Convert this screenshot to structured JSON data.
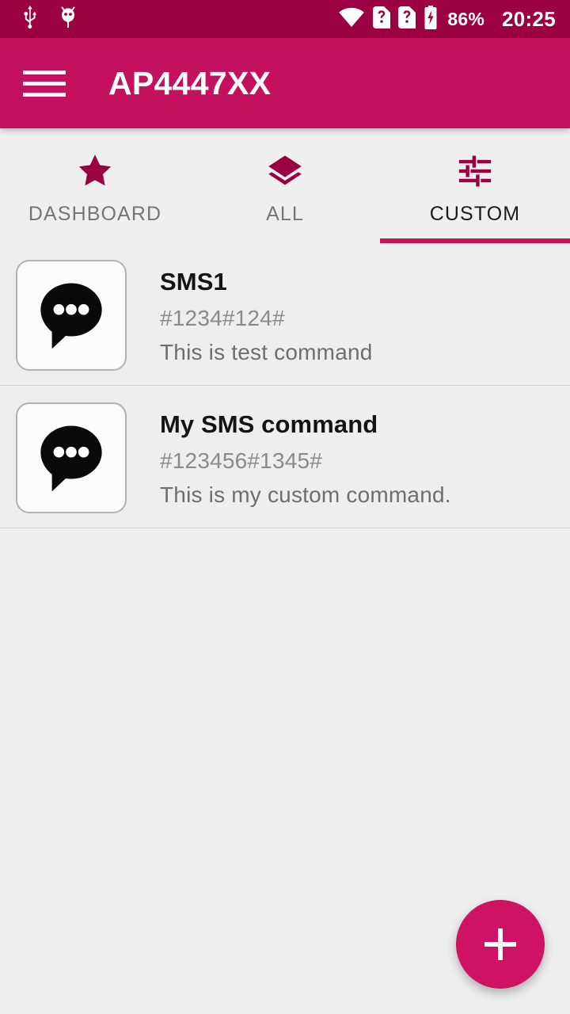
{
  "status_bar": {
    "icons": [
      "usb-icon",
      "android-debug-icon",
      "wifi-icon",
      "sim-unknown-icon-1",
      "sim-unknown-icon-2",
      "battery-charging-icon"
    ],
    "battery_percent": "86%",
    "time": "20:25",
    "background_color": "#9B0040"
  },
  "app_bar": {
    "menu_icon": "hamburger-menu-icon",
    "title": "AP4447XX",
    "background_color": "#C4115F"
  },
  "tabs": {
    "active_index": 2,
    "indicator_color": "#C2185B",
    "items": [
      {
        "label": "DASHBOARD",
        "icon": "star-icon"
      },
      {
        "label": "ALL",
        "icon": "layers-icon"
      },
      {
        "label": "CUSTOM",
        "icon": "tune-icon"
      }
    ]
  },
  "list": {
    "items": [
      {
        "icon": "sms-bubble-icon",
        "title": "SMS1",
        "code": "#1234#124#",
        "description": "This is test command"
      },
      {
        "icon": "sms-bubble-icon",
        "title": "My SMS command",
        "code": "#123456#1345#",
        "description": "This is my custom command."
      }
    ]
  },
  "fab": {
    "icon": "plus-icon",
    "label": "Add command",
    "color": "#CE1264"
  }
}
